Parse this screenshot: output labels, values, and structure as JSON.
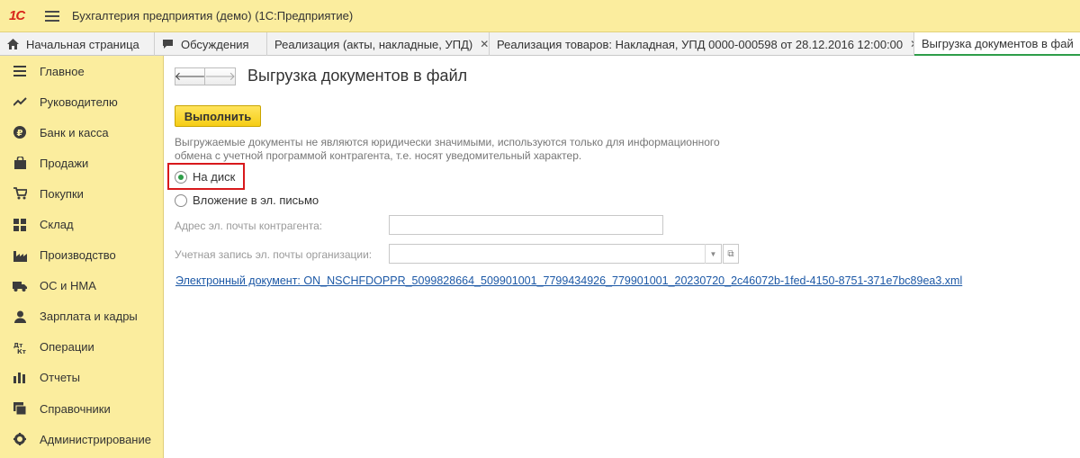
{
  "app": {
    "logo_text": "1С",
    "title": "Бухгалтерия предприятия (демо)  (1С:Предприятие)"
  },
  "tabs": [
    {
      "label": "Начальная страница",
      "icon": "home-icon",
      "closable": false
    },
    {
      "label": "Обсуждения",
      "icon": "chat-icon",
      "closable": false
    },
    {
      "label": "Реализация (акты, накладные, УПД)",
      "icon": "",
      "closable": true
    },
    {
      "label": "Реализация товаров: Накладная, УПД 0000-000598 от 28.12.2016 12:00:00",
      "icon": "",
      "closable": true
    },
    {
      "label": "Выгрузка документов в фай",
      "icon": "",
      "closable": false
    }
  ],
  "sidebar": {
    "items": [
      {
        "label": "Главное",
        "icon": "menu-lines-icon"
      },
      {
        "label": "Руководителю",
        "icon": "trend-icon"
      },
      {
        "label": "Банк и касса",
        "icon": "ruble-icon"
      },
      {
        "label": "Продажи",
        "icon": "bag-icon"
      },
      {
        "label": "Покупки",
        "icon": "cart-icon"
      },
      {
        "label": "Склад",
        "icon": "warehouse-icon"
      },
      {
        "label": "Производство",
        "icon": "factory-icon"
      },
      {
        "label": "ОС и НМА",
        "icon": "truck-icon"
      },
      {
        "label": "Зарплата и кадры",
        "icon": "person-icon"
      },
      {
        "label": "Операции",
        "icon": "dt-kt-icon"
      },
      {
        "label": "Отчеты",
        "icon": "bar-chart-icon"
      },
      {
        "label": "Справочники",
        "icon": "books-icon"
      },
      {
        "label": "Администрирование",
        "icon": "gear-icon"
      }
    ]
  },
  "form": {
    "title": "Выгрузка документов в файл",
    "run_button": "Выполнить",
    "notice": "Выгружаемые документы не являются юридически значимыми, используются только для информационного обмена с учетной программой контрагента, т.е. носят уведомительный характер.",
    "radio_disk": "На диск",
    "radio_email": "Вложение в эл. письмо",
    "selected_option": "На диск",
    "email_label": "Адрес эл. почты контрагента:",
    "email_value": "",
    "account_label": "Учетная запись эл. почты организации:",
    "account_value": "",
    "doc_link": "Электронный документ: ON_NSCHFDOPPR_5099828664_509901001_7799434926_779901001_20230720_2c46072b-1fed-4150-8751-371e7bc89ea3.xml"
  },
  "colors": {
    "sidebar_bg": "#fbed9e",
    "run_button": "#f6cd16",
    "highlight_frame": "#d8191c",
    "link": "#1c58a6",
    "radio_selected": "#2e9d49"
  }
}
